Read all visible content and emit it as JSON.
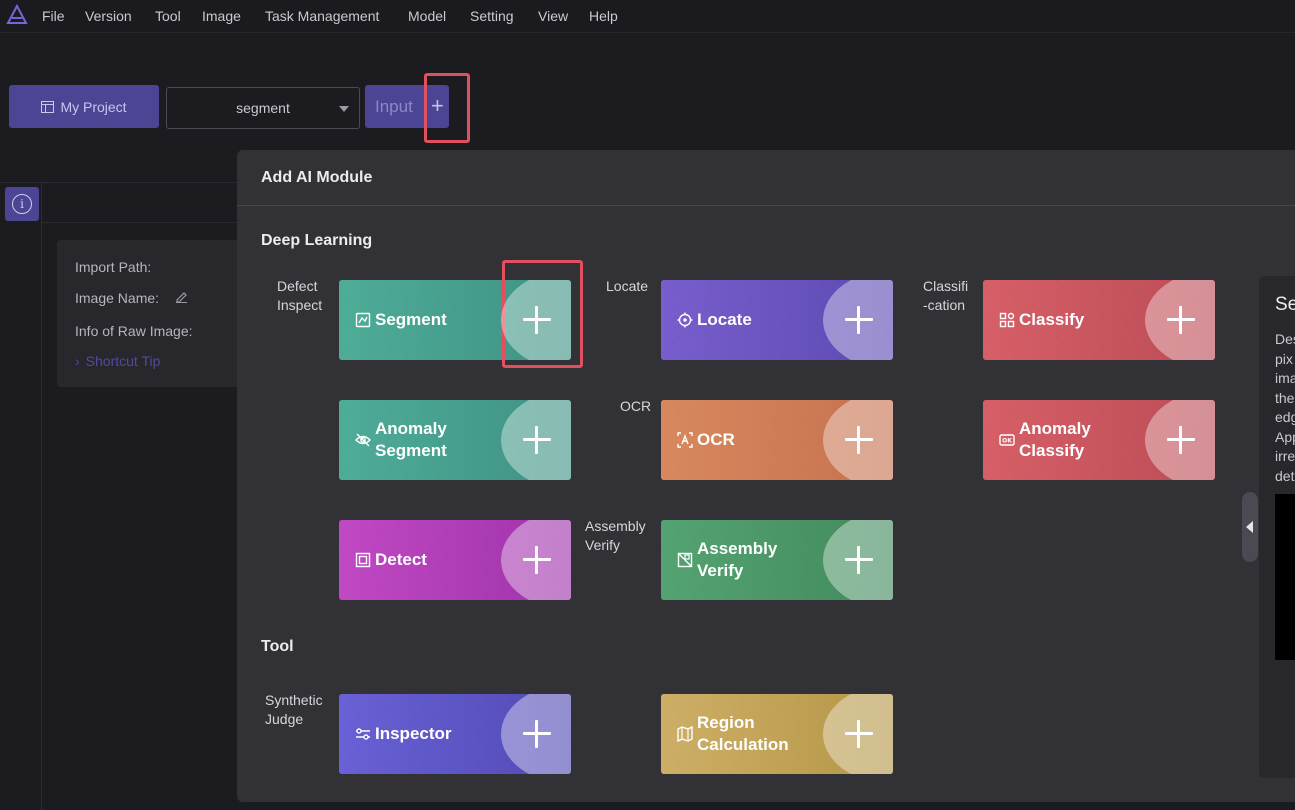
{
  "menu": [
    "File",
    "Version",
    "Tool",
    "Image",
    "Task Management",
    "Model",
    "Setting",
    "View",
    "Help"
  ],
  "toolbar": {
    "project_label": "My Project",
    "select_value": "segment",
    "input_label": "Input",
    "add_icon": "plus-icon"
  },
  "info_panel": {
    "import_path": "Import Path:",
    "image_name": "Image Name:",
    "raw_info": "Info of Raw Image:",
    "shortcut": "Shortcut Tip"
  },
  "modal": {
    "title": "Add AI Module",
    "sections": {
      "deep_learning": "Deep Learning",
      "tool": "Tool"
    },
    "categories": {
      "defect": "Defect\nInspect",
      "locate": "Locate",
      "classification": "Classifi\n-cation",
      "ocr": "OCR",
      "assembly": "Assembly\nVerify",
      "synthetic": "Synthetic\nJudge"
    },
    "cards": {
      "segment": "Segment",
      "locate": "Locate",
      "classify": "Classify",
      "anomaly_segment": "Anomaly\nSegment",
      "ocr": "OCR",
      "anomaly_classify": "Anomaly\nClassify",
      "detect": "Detect",
      "assembly_verify": "Assembly\nVerify",
      "inspector": "Inspector",
      "region_calculation": "Region\nCalculation"
    }
  },
  "side_panel": {
    "title": "Se",
    "description": "Des\npix\nima\nthe\nedg\nApp\nirre\ndet"
  },
  "colors": {
    "accent": "#4b4594",
    "highlight": "#e0505f",
    "teal": "#45a28f",
    "purple": "#6c55c0",
    "red": "#c9565d",
    "orange": "#cf7d57",
    "magenta": "#b03db8",
    "green": "#4d9a6a",
    "indigo": "#5e57c8",
    "gold": "#c2a35a"
  }
}
